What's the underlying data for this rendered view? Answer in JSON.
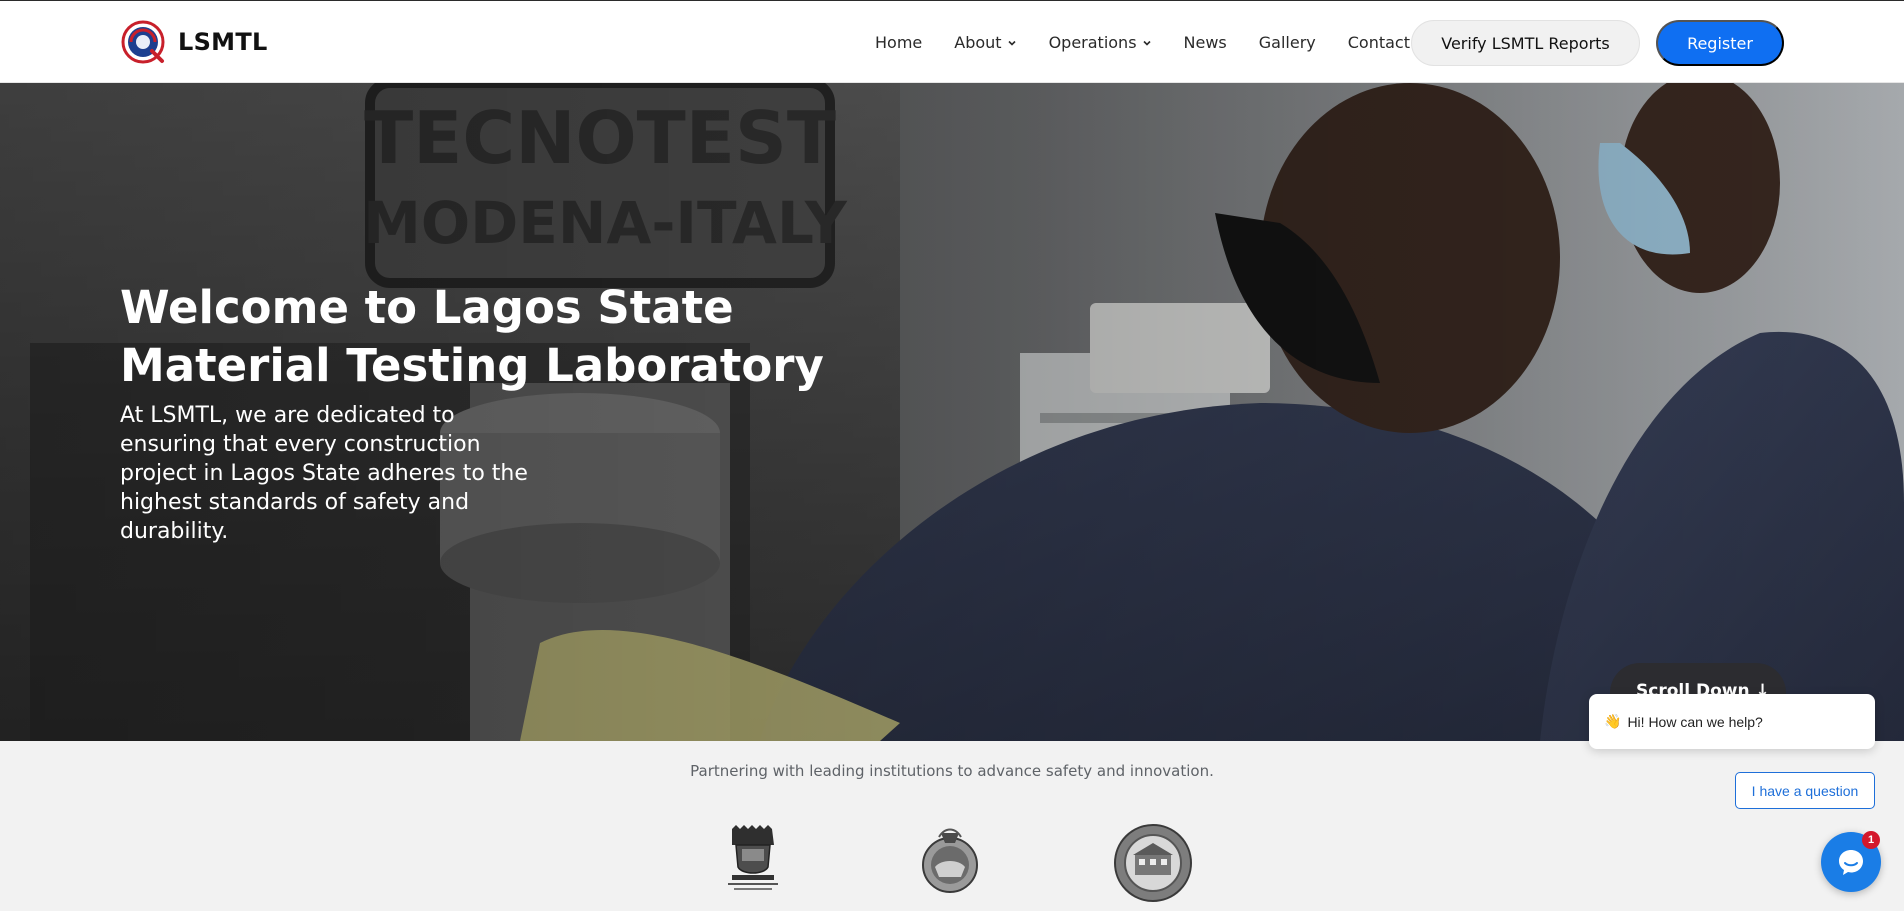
{
  "header": {
    "brand_name": "LSMTL",
    "nav": [
      {
        "label": "Home",
        "has_dropdown": false
      },
      {
        "label": "About",
        "has_dropdown": true
      },
      {
        "label": "Operations",
        "has_dropdown": true
      },
      {
        "label": "News",
        "has_dropdown": false
      },
      {
        "label": "Gallery",
        "has_dropdown": false
      },
      {
        "label": "Contact",
        "has_dropdown": false
      }
    ],
    "verify_button": "Verify LSMTL Reports",
    "register_button": "Register",
    "register_color": "#0f6ff2"
  },
  "hero": {
    "title": "Welcome to Lagos State Material Testing Laboratory",
    "subtitle": "At LSMTL, we are dedicated to ensuring that every construction project in Lagos State adheres to the highest standards of safety and durability.",
    "scroll_label": "Scroll Down  ↓",
    "background_icon": "lab-technicians-photo"
  },
  "partners": {
    "tagline": "Partnering with leading institutions to advance safety and innovation.",
    "logos": [
      "lagos-state-government-logo",
      "lagos-state-crest-logo",
      "lagos-state-building-control-agency-logo"
    ]
  },
  "chat": {
    "greeting_emoji": "👋",
    "greeting": "Hi! How can we help?",
    "question_button": "I have a question",
    "badge_count": "1",
    "accent_color": "#1e6fd9"
  }
}
